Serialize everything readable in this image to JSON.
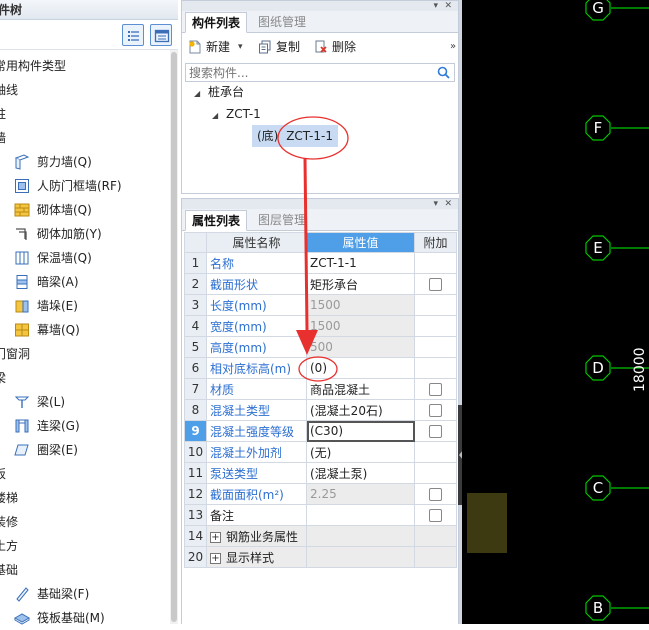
{
  "left_panel": {
    "title": "构件树",
    "items": [
      {
        "label": "常用构件类型",
        "level": 0,
        "icon": "none"
      },
      {
        "label": "轴线",
        "level": 0,
        "icon": "none"
      },
      {
        "label": "柱",
        "level": 0,
        "icon": "none"
      },
      {
        "label": "墙",
        "level": 0,
        "icon": "none"
      },
      {
        "label": "剪力墙(Q)",
        "level": 1,
        "icon": "shear-wall-icon"
      },
      {
        "label": "人防门框墙(RF)",
        "level": 1,
        "icon": "civil-defense-wall-icon"
      },
      {
        "label": "砌体墙(Q)",
        "level": 1,
        "icon": "masonry-wall-icon"
      },
      {
        "label": "砌体加筋(Y)",
        "level": 1,
        "icon": "masonry-rebar-icon"
      },
      {
        "label": "保温墙(Q)",
        "level": 1,
        "icon": "insulation-wall-icon"
      },
      {
        "label": "暗梁(A)",
        "level": 1,
        "icon": "hidden-beam-icon"
      },
      {
        "label": "墙垛(E)",
        "level": 1,
        "icon": "wall-pier-icon"
      },
      {
        "label": "幕墙(Q)",
        "level": 1,
        "icon": "curtain-wall-icon"
      },
      {
        "label": "门窗洞",
        "level": 0,
        "icon": "none"
      },
      {
        "label": "梁",
        "level": 0,
        "icon": "none"
      },
      {
        "label": "梁(L)",
        "level": 1,
        "icon": "beam-icon"
      },
      {
        "label": "连梁(G)",
        "level": 1,
        "icon": "coupling-beam-icon"
      },
      {
        "label": "圈梁(E)",
        "level": 1,
        "icon": "ring-beam-icon"
      },
      {
        "label": "板",
        "level": 0,
        "icon": "none"
      },
      {
        "label": "楼梯",
        "level": 0,
        "icon": "none"
      },
      {
        "label": "装修",
        "level": 0,
        "icon": "none"
      },
      {
        "label": "土方",
        "level": 0,
        "icon": "none"
      },
      {
        "label": "基础",
        "level": 0,
        "icon": "none"
      },
      {
        "label": "基础梁(F)",
        "level": 1,
        "icon": "foundation-beam-icon"
      },
      {
        "label": "筏板基础(M)",
        "level": 1,
        "icon": "raft-foundation-icon"
      }
    ]
  },
  "component_panel": {
    "tabs": [
      {
        "label": "构件列表",
        "active": true
      },
      {
        "label": "图纸管理",
        "active": false
      }
    ],
    "toolbar": {
      "new_label": "新建",
      "copy_label": "复制",
      "delete_label": "删除"
    },
    "search_placeholder": "搜索构件...",
    "tree": {
      "root": "桩承台",
      "child": "ZCT-1",
      "leaf_prefix": "(底)",
      "leaf_name": "ZCT-1-1"
    }
  },
  "property_panel": {
    "tabs": [
      {
        "label": "属性列表",
        "active": true
      },
      {
        "label": "图层管理",
        "active": false
      }
    ],
    "headers": {
      "name": "属性名称",
      "value": "属性值",
      "extra": "附加"
    },
    "rows": [
      {
        "num": "1",
        "name": "名称",
        "value": "ZCT-1-1",
        "blue": true,
        "gray": false,
        "checkbox": false
      },
      {
        "num": "2",
        "name": "截面形状",
        "value": "矩形承台",
        "blue": true,
        "gray": false,
        "checkbox": true
      },
      {
        "num": "3",
        "name": "长度(mm)",
        "value": "1500",
        "blue": true,
        "gray": true,
        "checkbox": false
      },
      {
        "num": "4",
        "name": "宽度(mm)",
        "value": "1500",
        "blue": true,
        "gray": true,
        "checkbox": false
      },
      {
        "num": "5",
        "name": "高度(mm)",
        "value": "500",
        "blue": true,
        "gray": true,
        "checkbox": false
      },
      {
        "num": "6",
        "name": "相对底标高(m)",
        "value": "(0)",
        "blue": true,
        "gray": false,
        "checkbox": false
      },
      {
        "num": "7",
        "name": "材质",
        "value": "商品混凝土",
        "blue": true,
        "gray": false,
        "checkbox": true
      },
      {
        "num": "8",
        "name": "混凝土类型",
        "value": "(混凝土20石)",
        "blue": true,
        "gray": false,
        "checkbox": true
      },
      {
        "num": "9",
        "name": "混凝土强度等级",
        "value": "(C30)",
        "blue": true,
        "gray": false,
        "checkbox": true,
        "selected": true
      },
      {
        "num": "10",
        "name": "混凝土外加剂",
        "value": "(无)",
        "blue": true,
        "gray": false,
        "checkbox": false
      },
      {
        "num": "11",
        "name": "泵送类型",
        "value": "(混凝土泵)",
        "blue": true,
        "gray": false,
        "checkbox": false
      },
      {
        "num": "12",
        "name": "截面面积(m²)",
        "value": "2.25",
        "blue": true,
        "gray": true,
        "checkbox": true
      },
      {
        "num": "13",
        "name": "备注",
        "value": "",
        "blue": false,
        "gray": false,
        "checkbox": true
      },
      {
        "num": "14",
        "name": "钢筋业务属性",
        "value": "",
        "blue": false,
        "gray": false,
        "checkbox": false,
        "group": true
      },
      {
        "num": "20",
        "name": "显示样式",
        "value": "",
        "blue": false,
        "gray": false,
        "checkbox": false,
        "group": true
      }
    ]
  },
  "canvas": {
    "axis_labels": [
      "G",
      "F",
      "E",
      "D",
      "C",
      "B"
    ],
    "dimension_text": "18000",
    "axis_color": "#00c400",
    "background": "#000000"
  },
  "annotations": {
    "color": "#e8312e"
  }
}
